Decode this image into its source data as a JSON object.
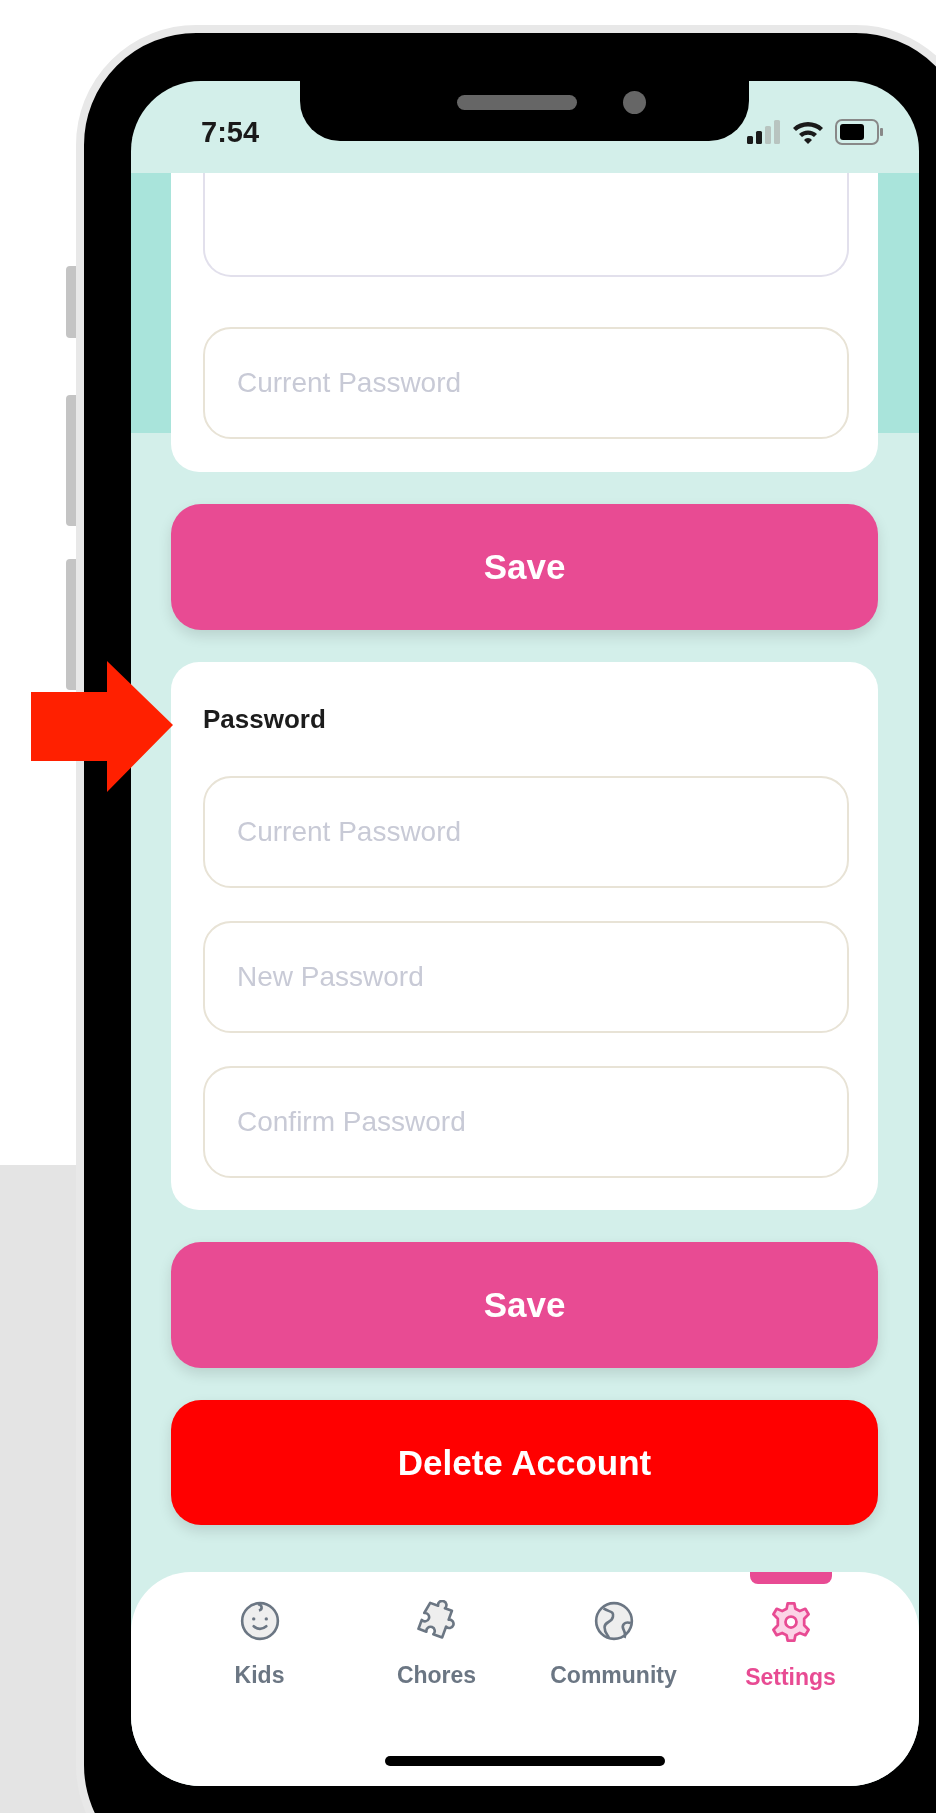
{
  "status_bar": {
    "time": "7:54"
  },
  "profile_section": {
    "current_password": {
      "placeholder": "Current Password"
    },
    "save_button": "Save"
  },
  "password_section": {
    "title": "Password",
    "fields": [
      {
        "placeholder": "Current Password"
      },
      {
        "placeholder": "New Password"
      },
      {
        "placeholder": "Confirm Password"
      }
    ],
    "save_button": "Save"
  },
  "delete_button": "Delete Account",
  "tab_bar": [
    {
      "label": "Kids",
      "kind": "face",
      "selected": false
    },
    {
      "label": "Chores",
      "kind": "puzzle",
      "selected": false
    },
    {
      "label": "Community",
      "kind": "globe",
      "selected": false
    },
    {
      "label": "Settings",
      "kind": "gear",
      "selected": true
    }
  ]
}
